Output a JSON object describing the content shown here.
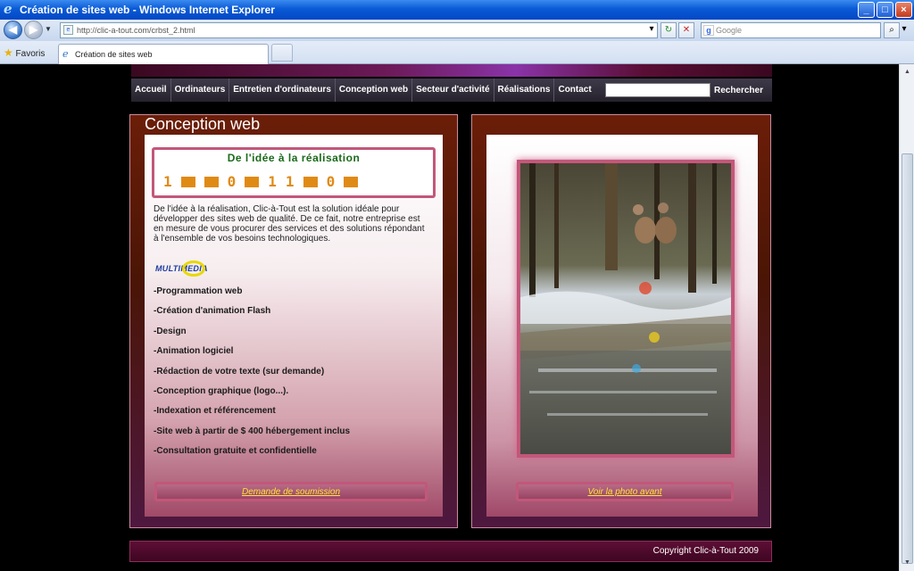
{
  "window": {
    "title": "Création de sites web - Windows Internet Explorer",
    "controls": [
      "_",
      "□",
      "×"
    ]
  },
  "address_bar": {
    "url": "http://clic-a-tout.com/crbst_2.html",
    "search_placeholder": "Google"
  },
  "favorites": {
    "label": "Favoris"
  },
  "tab": {
    "title": "Création de sites web"
  },
  "site_nav": {
    "items": [
      "Accueil",
      "Ordinateurs",
      "Entretien d'ordinateurs",
      "Conception web",
      "Secteur d'activité",
      "Réalisations",
      "Contact"
    ],
    "search_button": "Rechercher"
  },
  "left_panel": {
    "title": "Conception web",
    "banner_title": "De l'idée à la réalisation",
    "banner_digits": [
      "1",
      "",
      "",
      "0",
      "",
      "1",
      "1",
      "",
      "0",
      ""
    ],
    "intro": "De l'idée à la réalisation, Clic-à-Tout est la solution idéale pour développer des sites web de qualité. De ce fait, notre entreprise est en mesure de vous procurer des services et des solutions répondant à l'ensemble de vos besoins technologiques.",
    "logo_text": "MULTIMEDIA",
    "services": [
      "-Programmation web",
      "-Création d'animation Flash",
      "-Design",
      "-Animation logiciel",
      "-Rédaction de votre texte (sur demande)",
      "-Conception graphique (logo...).",
      "-Indexation et référencement",
      "-Site web à partir de $ 400 hébergement inclus",
      "-Consultation gratuite et confidentielle"
    ],
    "link": "Demande de soumission"
  },
  "right_panel": {
    "link": "Voir la photo avant"
  },
  "footer": {
    "copyright": "Copyright  Clic-à-Tout 2009"
  }
}
